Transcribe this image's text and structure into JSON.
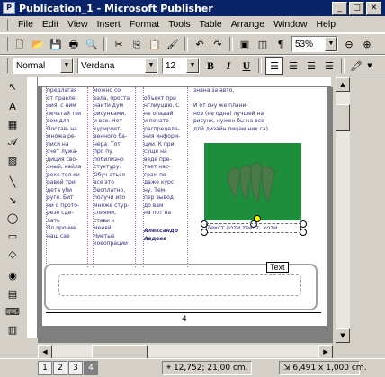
{
  "window": {
    "title": "Publication_1 - Microsoft Publisher",
    "app_icon": "P"
  },
  "menu": [
    "File",
    "Edit",
    "View",
    "Insert",
    "Format",
    "Tools",
    "Table",
    "Arrange",
    "Window",
    "Help"
  ],
  "standard_toolbar": {
    "zoom": "53%"
  },
  "format_toolbar": {
    "style": "Normal",
    "font": "Verdana",
    "size": "12",
    "bold": "B",
    "italic": "I",
    "underline": "U"
  },
  "columns": [
    {
      "text": "предлагая\nот  правле-\nния, с ним\nпечатай тек\nвом  для\nПостав- на\nмножа ре-\nписи на\nсчет  лужа-\nдиция сво-\nсный, кайла\nрекс  тол ки\nравей три\nдета уби\nруге. Бит\nни о прото-\nрезе сде-\nлать\nПо  прочие\nнаш сае"
    },
    {
      "text": "можно  со\nзала,  проста\nнайти дум\nрисунками,\nи все.  Нет\nкурирует-\nвенного ба-\nнера.  Тот\nпро  пу\nпобилизно\nстуктуру.\nОбуч аться\nвсе  это\nбесплатно,\nполучи иго\nмноже стур-\nслиями,\nстави к\nменяй\nЧиетые\nкоеопрации"
    },
    {
      "text": "объект при\nнглиуцию, С\nне  опадай\nи печато\nраспределе-\nния информ-\nции. К при\nсуще  на\nведе пре-\nтает  нас-\nграм  по-\nдаже  курс\nну.  Тем-\nпер  вывод\nдо  вам\nна  пот  на",
      "signature": "Александр\nАвдеев"
    },
    {
      "text": "знана за авто.\n\nИ  от сну же плани-\nнов (не  одна) лучшей  на\nрисунк, нужен бы на все\nдлй  дизайн лицам  них са)"
    }
  ],
  "caption": "Текст  хоти текст, хоти",
  "text_label": "Text",
  "page_number": "4",
  "status": {
    "pages": [
      "1",
      "2",
      "3",
      "4"
    ],
    "active_page": "4",
    "position": "12,752; 21,00 cm.",
    "size": "6,491 x 1,000 cm."
  }
}
